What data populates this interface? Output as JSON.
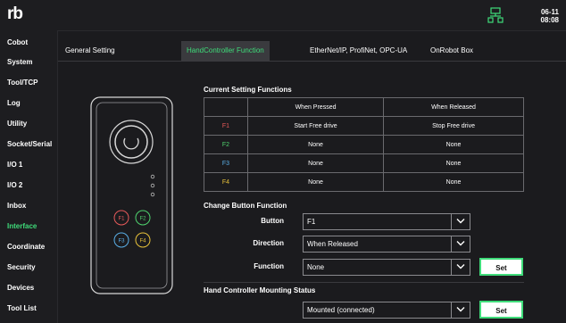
{
  "header": {
    "logo": "rb",
    "date": "06-11",
    "time": "08:08"
  },
  "sidebar": {
    "items": [
      {
        "label": "Cobot"
      },
      {
        "label": "System"
      },
      {
        "label": "Tool/TCP"
      },
      {
        "label": "Log"
      },
      {
        "label": "Utility"
      },
      {
        "label": "Socket/Serial"
      },
      {
        "label": "I/O 1"
      },
      {
        "label": "I/O 2"
      },
      {
        "label": "Inbox"
      },
      {
        "label": "Interface",
        "active": true
      },
      {
        "label": "Coordinate"
      },
      {
        "label": "Security"
      },
      {
        "label": "Devices"
      },
      {
        "label": "Tool List"
      }
    ]
  },
  "tabs": [
    {
      "label": "General Setting"
    },
    {
      "label": "HandController Function",
      "active": true
    },
    {
      "label": "EtherNet/IP, ProfiNet, OPC-UA"
    },
    {
      "label": "OnRobot Box"
    }
  ],
  "controller": {
    "buttons": [
      "F1",
      "F2",
      "F3",
      "F4"
    ]
  },
  "current": {
    "title": "Current Setting Functions",
    "headers": [
      "When Pressed",
      "When Released"
    ],
    "rows": [
      {
        "key": "F1",
        "pressed": "Start Free drive",
        "released": "Stop Free drive"
      },
      {
        "key": "F2",
        "pressed": "None",
        "released": "None"
      },
      {
        "key": "F3",
        "pressed": "None",
        "released": "None"
      },
      {
        "key": "F4",
        "pressed": "None",
        "released": "None"
      }
    ]
  },
  "change": {
    "title": "Change Button Function",
    "button_label": "Button",
    "button_value": "F1",
    "direction_label": "Direction",
    "direction_value": "When Released",
    "function_label": "Function",
    "function_value": "None",
    "set_label": "Set"
  },
  "mounting": {
    "title": "Hand Controller Mounting Status",
    "value": "Mounted (connected)",
    "set_label": "Set"
  },
  "colors": {
    "accent": "#3fdc7a",
    "f1": "#e85a5a",
    "f2": "#4fd36e",
    "f3": "#5ab0e8",
    "f4": "#e8c23a"
  }
}
